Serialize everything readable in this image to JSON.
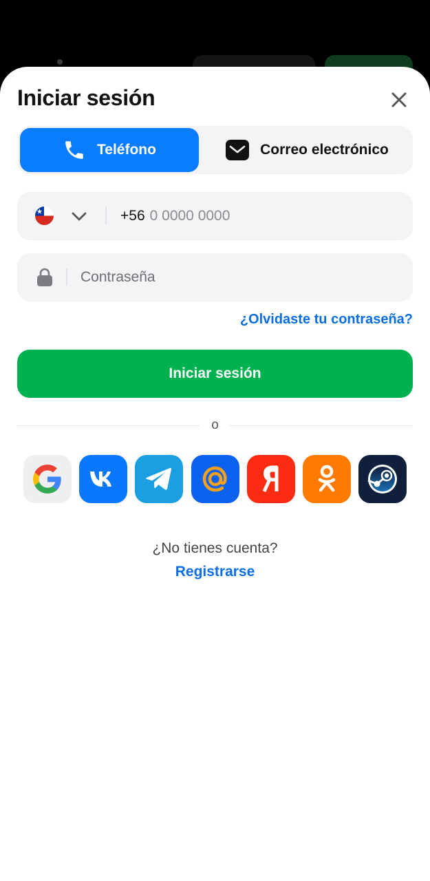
{
  "header": {
    "title": "Iniciar sesión"
  },
  "tabs": [
    {
      "label": "Teléfono",
      "active": true,
      "icon": "phone-icon"
    },
    {
      "label": "Correo electrónico",
      "active": false,
      "icon": "mail-icon"
    }
  ],
  "phone": {
    "country_flag": "chile-flag-icon",
    "country_code": "+56",
    "placeholder": "0 0000 0000"
  },
  "password": {
    "placeholder": "Contraseña",
    "icon": "lock-icon"
  },
  "forgot_link": "¿Olvidaste tu contraseña?",
  "login_button": "Iniciar sesión",
  "divider_text": "o",
  "socials": [
    {
      "name": "google",
      "color": "#efeff2"
    },
    {
      "name": "vk",
      "color": "#0a77ff"
    },
    {
      "name": "telegram",
      "color": "#1c9fe0"
    },
    {
      "name": "mail-ru",
      "color": "#0a62ef"
    },
    {
      "name": "yandex",
      "color": "#fc2c12"
    },
    {
      "name": "odnoklassniki",
      "color": "#ff7a00"
    },
    {
      "name": "steam",
      "color": "#101f3c"
    }
  ],
  "footer": {
    "no_account": "¿No tienes cuenta?",
    "register": "Registrarse"
  },
  "colors": {
    "primary_blue": "#0a7cff",
    "link_blue": "#0a6ee0",
    "green": "#00b14f"
  }
}
